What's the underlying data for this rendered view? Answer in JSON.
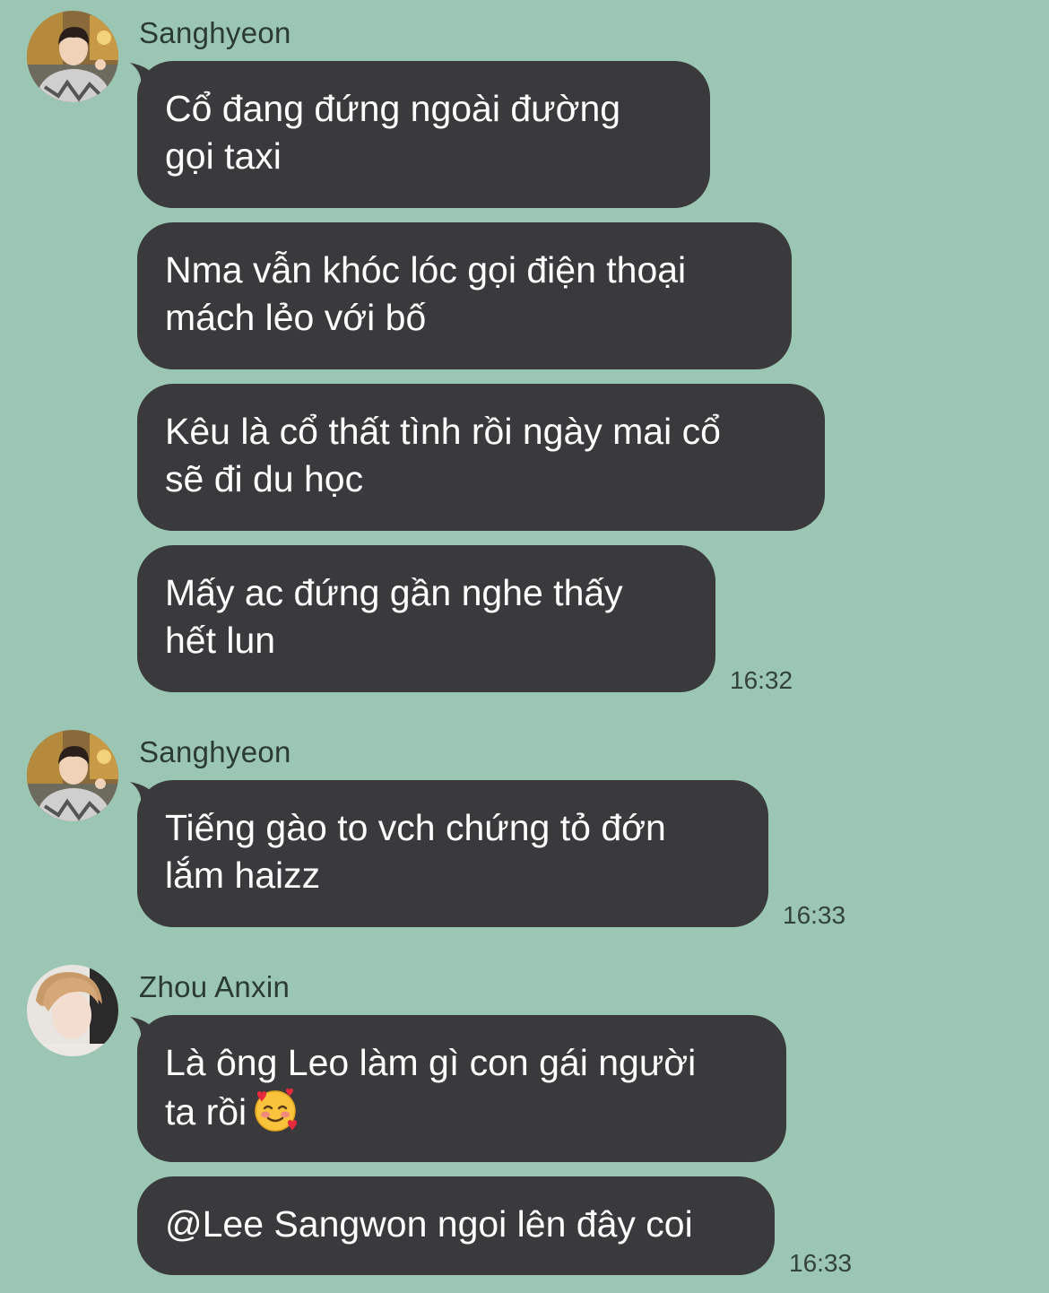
{
  "groups": [
    {
      "sender": "Sanghyeon",
      "avatar_icon": "person-photo-avatar",
      "messages": [
        {
          "lines": [
            "Cổ đang đứng ngoài đường",
            "gọi taxi"
          ]
        },
        {
          "lines": [
            "Nma vẫn khóc lóc gọi điện thoại",
            "mách lẻo với bố"
          ]
        },
        {
          "lines": [
            "Kêu là cổ thất tình rồi ngày mai cổ",
            "sẽ đi du học"
          ]
        },
        {
          "lines": [
            "Mấy ac đứng gần nghe thấy",
            "hết lun"
          ]
        }
      ],
      "time": "16:32"
    },
    {
      "sender": "Sanghyeon",
      "avatar_icon": "person-photo-avatar",
      "messages": [
        {
          "lines": [
            "Tiếng gào to vch chứng tỏ đớn",
            "lắm haizz"
          ]
        }
      ],
      "time": "16:33"
    },
    {
      "sender": "Zhou Anxin",
      "avatar_icon": "person-photo-avatar",
      "messages": [
        {
          "lines": [
            "Là ông Leo làm gì con gái người",
            "ta rồi"
          ],
          "emoji": "smiling-face-with-hearts-icon"
        },
        {
          "lines": [
            "@Lee Sangwon ngoi lên đây coi"
          ]
        }
      ],
      "time": "16:33"
    }
  ],
  "colors": {
    "background": "#9cc6b4",
    "bubble": "#3a3a3c",
    "bubble_text": "#ffffff",
    "meta_text": "#2b3a34"
  }
}
